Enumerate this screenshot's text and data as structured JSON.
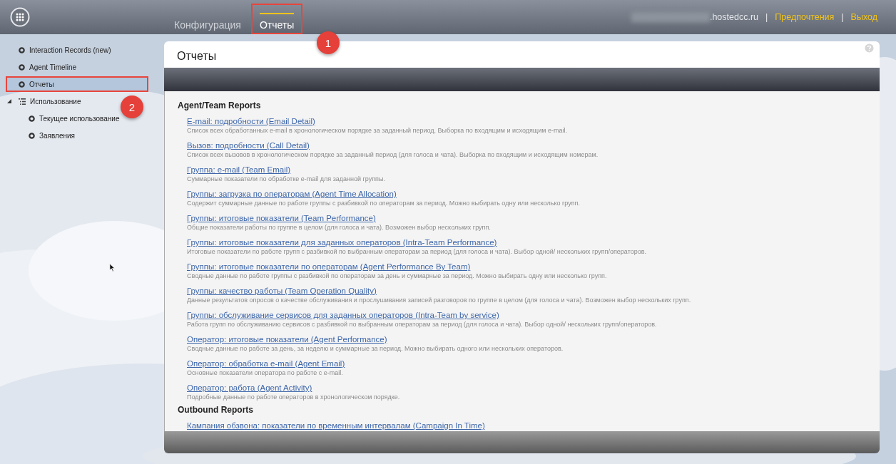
{
  "header": {
    "tabs": [
      {
        "label": "Конфигурация",
        "selected": false,
        "annotated": false
      },
      {
        "label": "Отчеты",
        "selected": true,
        "annotated": true
      }
    ],
    "items": [
      {
        "kind": "redacted"
      },
      {
        "kind": "text",
        "text": ".hostedcc.ru"
      },
      {
        "kind": "separator",
        "text": "|"
      },
      {
        "kind": "link",
        "text": "Предпочтения"
      },
      {
        "kind": "separator",
        "text": "|"
      },
      {
        "kind": "link",
        "text": "Выход"
      }
    ]
  },
  "sidebar": {
    "items": [
      {
        "label": "Interaction Records (new)",
        "selected": false,
        "annotated": false
      },
      {
        "label": "Agent Timeline",
        "selected": false,
        "annotated": false
      },
      {
        "label": "Отчеты",
        "selected": true,
        "annotated": true
      },
      {
        "label": "Использование",
        "selected": false,
        "annotated": false,
        "expanded": true,
        "children": [
          {
            "label": "Текущее использование",
            "selected": false,
            "annotated": false
          },
          {
            "label": "Заявления",
            "selected": false,
            "annotated": false
          }
        ]
      }
    ]
  },
  "annotations": [
    {
      "label": "1"
    },
    {
      "label": "2"
    }
  ],
  "panel": {
    "title": "Отчеты",
    "sections": [
      {
        "heading": "Agent/Team Reports",
        "reports": [
          {
            "title": "E-mail: подробности (Email Detail)",
            "description": "Список всех обработанных e-mail в хронологическом порядке за заданный период. Выборка по входящим и исходящим e-mail."
          },
          {
            "title": "Вызов: подробности (Call Detail)",
            "description": "Список всех вызовов в хронологическом порядке за заданный период (для голоса и чата). Выборка по входящим и исходящим номерам."
          },
          {
            "title": "Группа: e-mail (Team Email)",
            "description": "Суммарные показатели по обработке e-mail для заданной группы."
          },
          {
            "title": "Группы: загрузка по операторам (Agent Time Allocation)",
            "description": "Содержит суммарные данные по работе группы с разбивкой по операторам за период. Можно выбирать одну или несколько групп."
          },
          {
            "title": "Группы: итоговые показатели (Team Performance)",
            "description": "Общие показатели работы по группе в целом (для голоса и чата). Возможен выбор нескольких групп."
          },
          {
            "title": "Группы: итоговые показатели для заданных операторов (Intra-Team Performance)",
            "description": "Итоговые показатели по работе групп с разбивкой по выбранным операторам за период (для голоса и чата). Выбор одной/ нескольких групп/операторов."
          },
          {
            "title": "Группы: итоговые показатели по операторам (Agent Performance By Team)",
            "description": "Сводные данные по работе группы с разбивкой по операторам за день и суммарные за период. Можно выбирать одну или несколько групп."
          },
          {
            "title": "Группы: качество работы (Team Operation Quality)",
            "description": "Данные результатов опросов о качестве обслуживания и прослушивания записей разговоров по группе в целом (для голоса и чата). Возможен выбор нескольких групп."
          },
          {
            "title": "Группы: обслуживание сервисов для заданных операторов (Intra-Team by service)",
            "description": "Работа групп по обслуживанию сервисов с разбивкой по выбранным операторам за период (для голоса и чата). Выбор одной/ нескольких групп/операторов."
          },
          {
            "title": "Оператор: итоговые показатели (Agent Performance)",
            "description": "Сводные данные по работе за день, за неделю и суммарные за период. Можно выбирать одного или нескольких операторов."
          },
          {
            "title": "Оператор: обработка e-mail (Agent Email)",
            "description": "Основные показатели оператора по работе с e-mail."
          },
          {
            "title": "Оператор: работа (Agent Activity)",
            "description": "Подробные данные по работе операторов в хронологическом порядке."
          }
        ]
      },
      {
        "heading": "Outbound Reports",
        "reports": [
          {
            "title": "Кампания обзвона: показатели по временным интервалам (Campaign In Time)"
          }
        ]
      }
    ]
  }
}
